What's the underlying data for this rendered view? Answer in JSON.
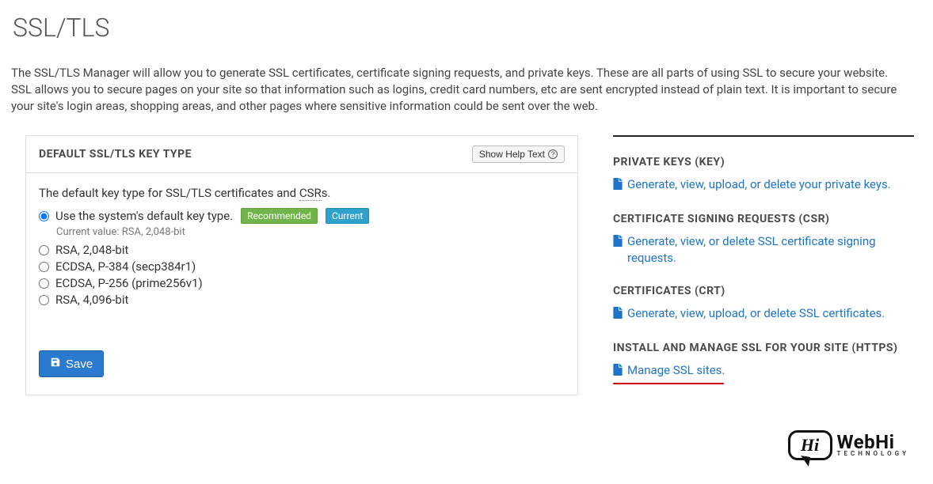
{
  "page": {
    "title": "SSL/TLS",
    "intro": "The SSL/TLS Manager will allow you to generate SSL certificates, certificate signing requests, and private keys. These are all parts of using SSL to secure your website. SSL allows you to secure pages on your site so that information such as logins, credit card numbers, etc are sent encrypted instead of plain text. It is important to secure your site's login areas, shopping areas, and other pages where sensitive information could be sent over the web."
  },
  "panel": {
    "heading": "DEFAULT SSL/TLS KEY TYPE",
    "help_label": "Show Help Text",
    "subdesc_pre": "The default key type for SSL/TLS certificates and ",
    "subdesc_csr": "CSR",
    "subdesc_post": "s.",
    "options": [
      "Use the system's default key type.",
      "RSA, 2,048-bit",
      "ECDSA, P-384 (secp384r1)",
      "ECDSA, P-256 (prime256v1)",
      "RSA, 4,096-bit"
    ],
    "recommended_badge": "Recommended",
    "current_badge": "Current",
    "current_value_label": "Current value: RSA, 2,048-bit",
    "save_label": "Save"
  },
  "sidebar": {
    "sections": [
      {
        "title": "PRIVATE KEYS (KEY)",
        "link": "Generate, view, upload, or delete your private keys."
      },
      {
        "title": "CERTIFICATE SIGNING REQUESTS (CSR)",
        "link": "Generate, view, or delete SSL certificate signing requests."
      },
      {
        "title": "CERTIFICATES (CRT)",
        "link": "Generate, view, upload, or delete SSL certificates."
      },
      {
        "title": "INSTALL AND MANAGE SSL FOR YOUR SITE (HTTPS)",
        "link": "Manage SSL sites."
      }
    ]
  },
  "watermark": {
    "hi": "Hi",
    "brand": "WebHi",
    "sub": "TECHNOLOGY"
  }
}
